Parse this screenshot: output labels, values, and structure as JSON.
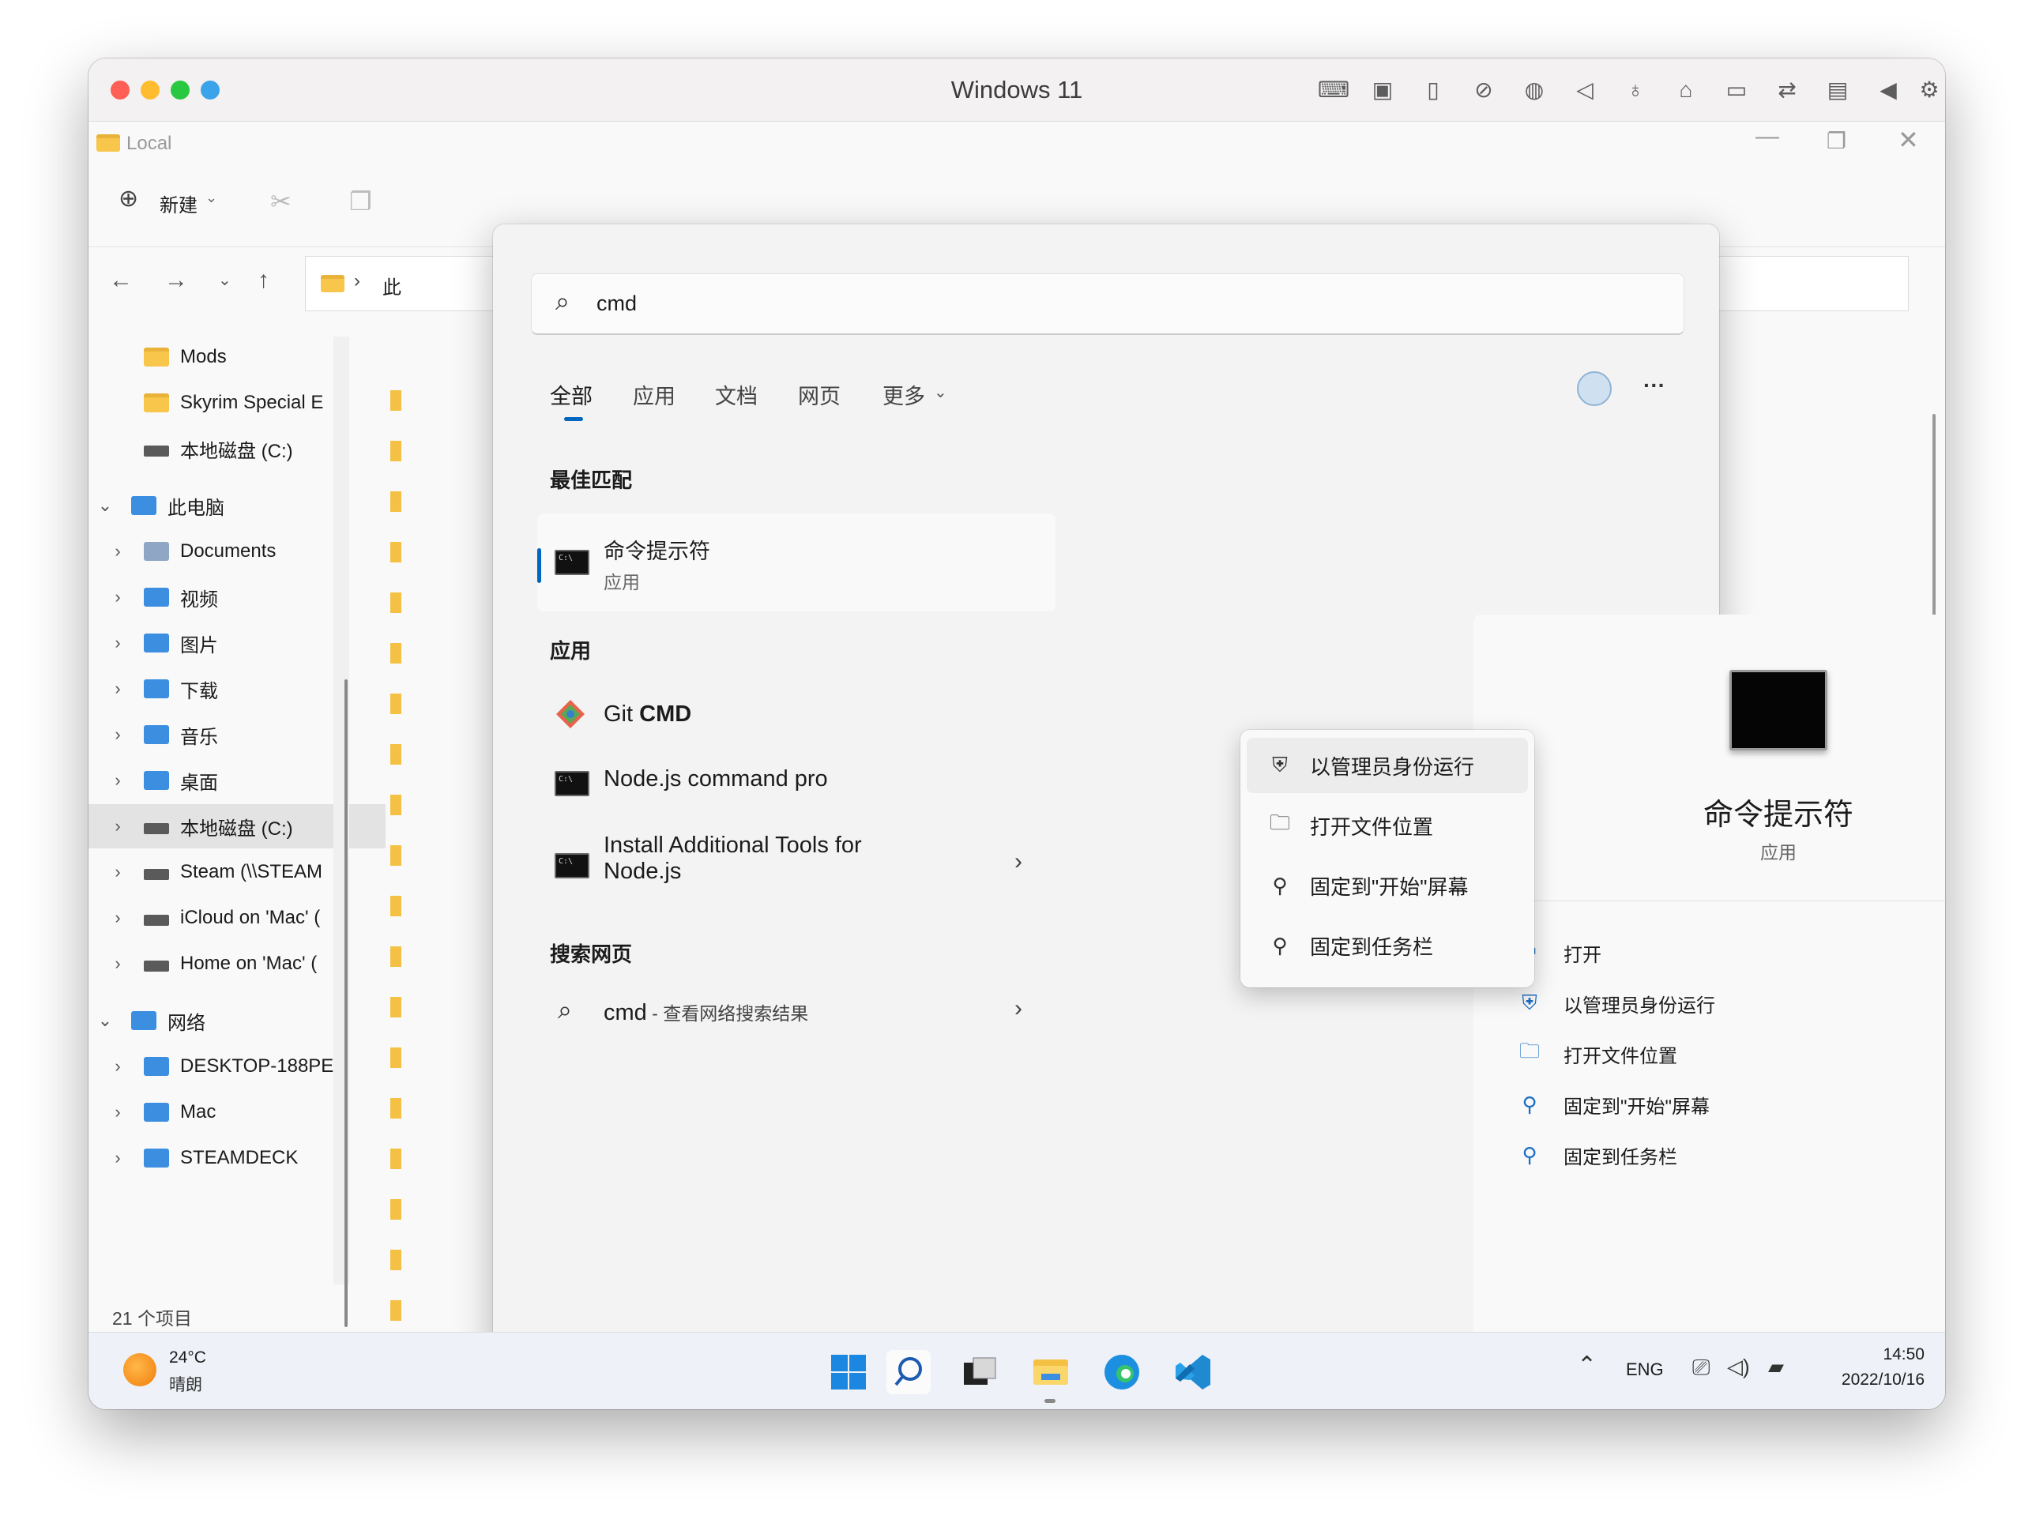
{
  "window": {
    "title": "Windows 11"
  },
  "explorer": {
    "title": "Local",
    "new_label": "新建",
    "breadcrumb_text": "此",
    "status_text": "21 个项目",
    "nav_items": [
      {
        "label": "Mods",
        "chevron": "",
        "icon": "folder"
      },
      {
        "label": "Skyrim Special E",
        "chevron": "",
        "icon": "folder"
      },
      {
        "label": "本地磁盘 (C:)",
        "chevron": "",
        "icon": "drive"
      },
      {
        "label": "此电脑",
        "chevron": "⌄",
        "icon": "pc"
      },
      {
        "label": "Documents",
        "chevron": "›",
        "icon": "doc"
      },
      {
        "label": "视频",
        "chevron": "›",
        "icon": "blue"
      },
      {
        "label": "图片",
        "chevron": "›",
        "icon": "blue"
      },
      {
        "label": "下载",
        "chevron": "›",
        "icon": "blue"
      },
      {
        "label": "音乐",
        "chevron": "›",
        "icon": "blue"
      },
      {
        "label": "桌面",
        "chevron": "›",
        "icon": "blue"
      },
      {
        "label": "本地磁盘 (C:)",
        "chevron": "›",
        "icon": "drive",
        "selected": true
      },
      {
        "label": "Steam (\\\\STEAM",
        "chevron": "›",
        "icon": "drive"
      },
      {
        "label": "iCloud on 'Mac' (",
        "chevron": "›",
        "icon": "drive"
      },
      {
        "label": "Home on 'Mac' (",
        "chevron": "›",
        "icon": "drive"
      },
      {
        "label": "网络",
        "chevron": "⌄",
        "icon": "pc"
      },
      {
        "label": "DESKTOP-188PE",
        "chevron": "›",
        "icon": "pc"
      },
      {
        "label": "Mac",
        "chevron": "›",
        "icon": "pc"
      },
      {
        "label": "STEAMDECK",
        "chevron": "›",
        "icon": "pc"
      }
    ]
  },
  "search": {
    "query": "cmd",
    "tabs": [
      "全部",
      "应用",
      "文档",
      "网页",
      "更多"
    ],
    "best_match_heading": "最佳匹配",
    "best_match": {
      "title": "命令提示符",
      "subtitle": "应用"
    },
    "apps_heading": "应用",
    "apps": [
      {
        "label_plain": "Git ",
        "label_bold": "CMD"
      },
      {
        "label_plain": "Node.js command pro",
        "label_bold": ""
      },
      {
        "label_plain": "Install Additional Tools for",
        "label_line2": "Node.js"
      }
    ],
    "web_heading": "搜索网页",
    "web_result": {
      "query": "cmd",
      "hint": " - 查看网络搜索结果"
    },
    "more_icon": "···"
  },
  "context_menu": {
    "items": [
      {
        "label": "以管理员身份运行",
        "icon": "shield-icon"
      },
      {
        "label": "打开文件位置",
        "icon": "folder-icon"
      },
      {
        "label": "固定到\"开始\"屏幕",
        "icon": "pin-icon"
      },
      {
        "label": "固定到任务栏",
        "icon": "pin-icon"
      }
    ]
  },
  "preview": {
    "title": "命令提示符",
    "subtitle": "应用",
    "actions": [
      {
        "label": "打开",
        "icon": "open-icon"
      },
      {
        "label": "以管理员身份运行",
        "icon": "shield-icon"
      },
      {
        "label": "打开文件位置",
        "icon": "folder-icon"
      },
      {
        "label": "固定到\"开始\"屏幕",
        "icon": "pin-icon"
      },
      {
        "label": "固定到任务栏",
        "icon": "pin-icon"
      }
    ]
  },
  "taskbar": {
    "weather_temp": "24°C",
    "weather_desc": "晴朗",
    "lang": "ENG",
    "time": "14:50",
    "date": "2022/10/16"
  },
  "colors": {
    "accent": "#0067c0",
    "mac_red": "#fe5f57",
    "mac_yellow": "#febc2e",
    "mac_green": "#28c840",
    "mac_blue": "#3aa3ea"
  }
}
